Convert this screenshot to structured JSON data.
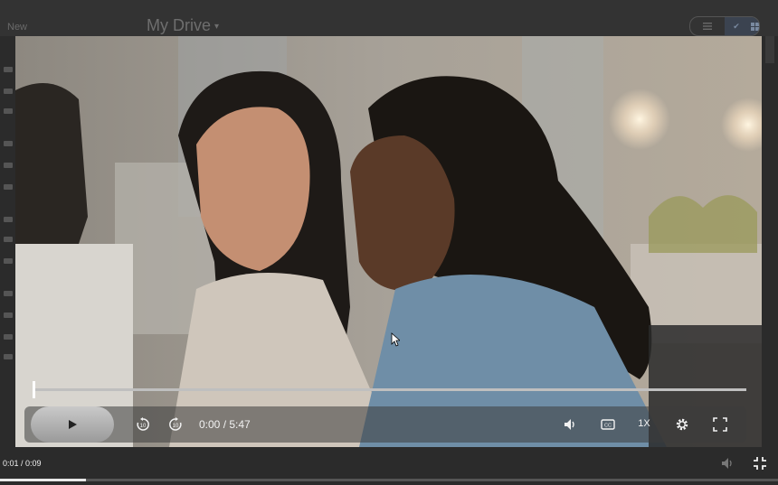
{
  "drive": {
    "new_label": "New",
    "title": "My Drive",
    "title_caret": "▾",
    "view_list_icon": "list-view-icon",
    "view_grid_icon": "grid-view-icon",
    "view_check": "✔"
  },
  "player": {
    "time": "0:00 / 5:47",
    "speed": "1X",
    "progress": 0.0,
    "icons": [
      "play-icon",
      "rewind-10-icon",
      "forward-10-icon",
      "volume-icon",
      "captions-icon",
      "settings-icon",
      "fullscreen-icon"
    ]
  },
  "outer_player": {
    "time": "0:01 / 0:09",
    "progress": 0.11,
    "icons": [
      "volume-icon",
      "exit-fullscreen-icon"
    ]
  },
  "colors": {
    "control_text": "#f2f2f2",
    "play_button": "#bdbdbd"
  }
}
